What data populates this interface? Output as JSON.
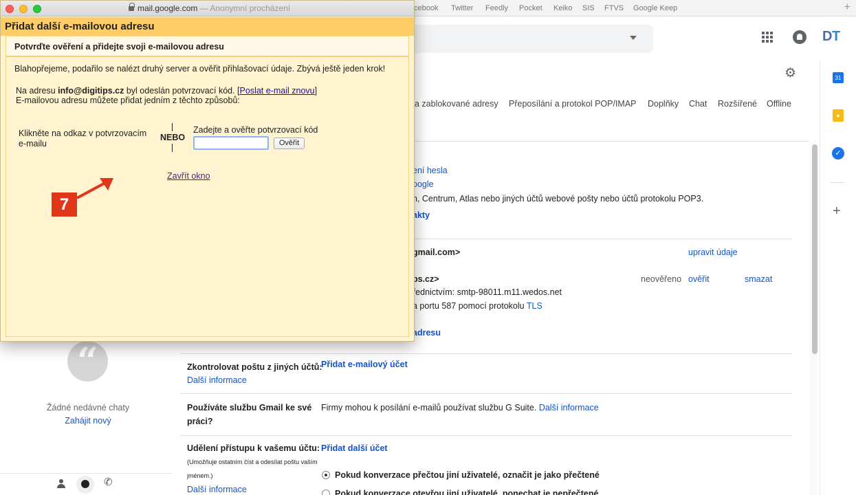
{
  "browser": {
    "url_domain": "mail.google.com",
    "url_suffix": " — Anonymní procházení",
    "bookmarks": [
      "cebook",
      "Twitter",
      "Feedly",
      "Pocket",
      "Keiko",
      "SIS",
      "FTVS",
      "Google Keep"
    ]
  },
  "header": {
    "avatar_initial_1": "D",
    "avatar_initial_2": "T"
  },
  "rail": {
    "calendar_day": "31"
  },
  "settings_tabs": [
    "a zablokované adresy",
    "Přeposílání a protokol POP/IMAP",
    "Doplňky",
    "Chat",
    "Rozšířené",
    "Offline"
  ],
  "accounts": {
    "frag_change_password": "ení hesla",
    "frag_google": "oogle",
    "frag_import_desc": "n, Centrum, Atlas nebo jiných účtů webové pošty nebo účtů protokolu POP3.",
    "frag_contacts": "akty",
    "frag_gmail_address": "gmail.com>",
    "edit_info": "upravit údaje",
    "frag_second_address": "ps.cz>",
    "status_unverified": "neověřeno",
    "verify": "ověřit",
    "delete": "smazat",
    "frag_smtp": "řednictvím: smtp-98011.m11.wedos.net",
    "frag_port_prefix": "a portu 587 pomocí protokolu ",
    "tls": "TLS",
    "frag_add_address": "adresu",
    "check_mail_label": "Zkontrolovat poštu z jiných účtů:",
    "more_info": "Další informace",
    "add_mail_account": "Přidat e-mailový účet",
    "gsuite_label_1": "Používáte službu Gmail ke své",
    "gsuite_label_2": "práci?",
    "gsuite_text": "Firmy mohou k posílání e-mailů používat službu G Suite. ",
    "grant_access_label": "Udělení přístupu k vašemu účtu:",
    "grant_access_note_1": "(Umožňuje ostatním číst a odesílat poštu vaším",
    "grant_access_note_2": "jménem.)",
    "add_another_account": "Přidat další účet",
    "radio_option_1": "Pokud konverzace přečtou jiní uživatelé, označit je jako přečtené",
    "radio_option_2": "Pokud konverzace otevřou jiní uživatelé, ponechat je nepřečtené"
  },
  "chat": {
    "empty_text": "Žádné nedávné chaty",
    "start_new": "Zahájit nový"
  },
  "popup": {
    "title": "Přidat další e-mailovou adresu",
    "subheading": "Potvrďte ověření a přidejte svoji e-mailovou adresu",
    "congrats": "Blahopřejeme, podařilo se nalézt druhý server a ověřit přihlašovací údaje. Zbývá ještě jeden krok!",
    "sent_prefix": "Na adresu ",
    "sent_email": "info@digitips.cz",
    "sent_suffix": " byl odeslán potvrzovací kód. [",
    "resend_link": "Poslat e-mail znovu",
    "bracket_close": "]",
    "methods_text": "E-mailovou adresu můžete přidat jedním z těchto způsobů:",
    "click_link_line1": "Klikněte na odkaz v potvrzovacím",
    "click_link_line2": "e-mailu",
    "or_divider": "NEBO",
    "enter_code_label": "Zadejte a ověřte potvrzovací kód",
    "code_value": "",
    "verify_button": "Ověřit",
    "close_window": "Zavřít okno",
    "step_number": "7"
  },
  "colors": {
    "popup_bg": "#fff3d0",
    "popup_header": "#ffcc66",
    "link": "#1155cc",
    "step_badge": "#e2361b"
  }
}
